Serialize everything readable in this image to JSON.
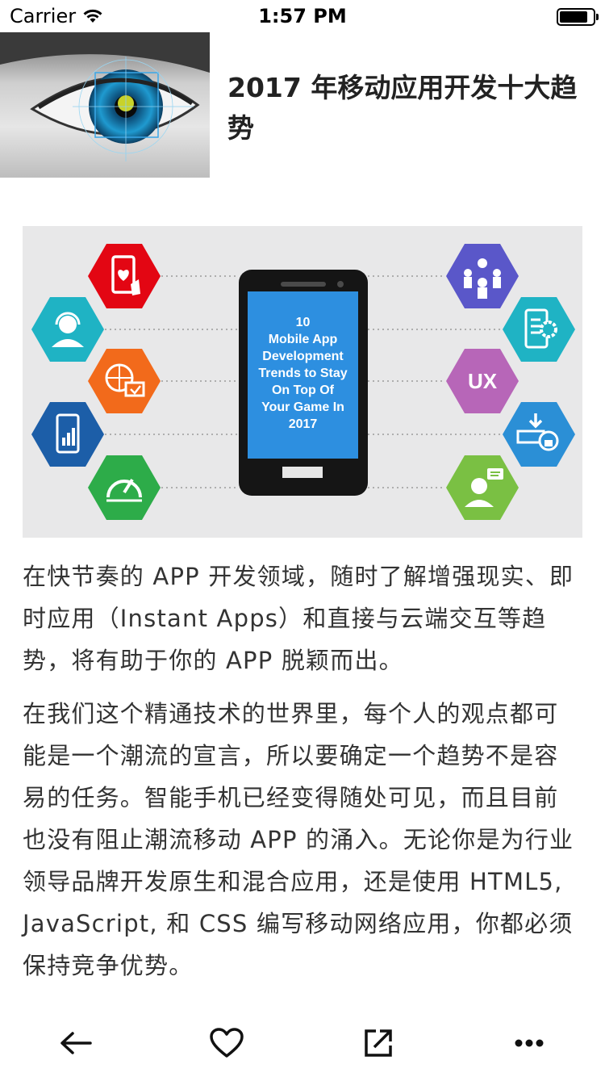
{
  "status_bar": {
    "carrier": "Carrier",
    "time": "1:57 PM"
  },
  "article": {
    "title": "2017 年移动应用开发十大趋势",
    "thumbnail_icon": "eye-scan-photo",
    "hero": {
      "phone_text": [
        "10",
        "Mobile App",
        "Development",
        "Trends to Stay",
        "On Top Of",
        "Your Game In",
        "2017"
      ],
      "ux_label": "UX"
    },
    "paragraphs": [
      "在快节奏的 APP 开发领域，随时了解增强现实、即时应用（Instant Apps）和直接与云端交互等趋势，将有助于你的 APP 脱颖而出。",
      "在我们这个精通技术的世界里，每个人的观点都可能是一个潮流的宣言，所以要确定一个趋势不是容易的任务。智能手机已经变得随处可见，而且目前也没有阻止潮流移动 APP 的涌入。无论你是为行业领导品牌开发原生和混合应用，还是使用 HTML5, JavaScript, 和 CSS 编写移动网络应用，你都必须保持竞争优势。"
    ]
  },
  "toolbar": {
    "icons": [
      "back-arrow-icon",
      "heart-icon",
      "share-icon",
      "more-icon"
    ]
  },
  "colors": {
    "hex_red": "#e30613",
    "hex_teal": "#1fb3c4",
    "hex_orange": "#f26a1b",
    "hex_blue": "#1c5ea8",
    "hex_green": "#2dac49",
    "hex_indigo": "#5a57c9",
    "hex_purple": "#b766b8",
    "hex_lightblue": "#2b8fd6",
    "hex_lime": "#7ac043",
    "phone_screen": "#2d8fe0"
  }
}
